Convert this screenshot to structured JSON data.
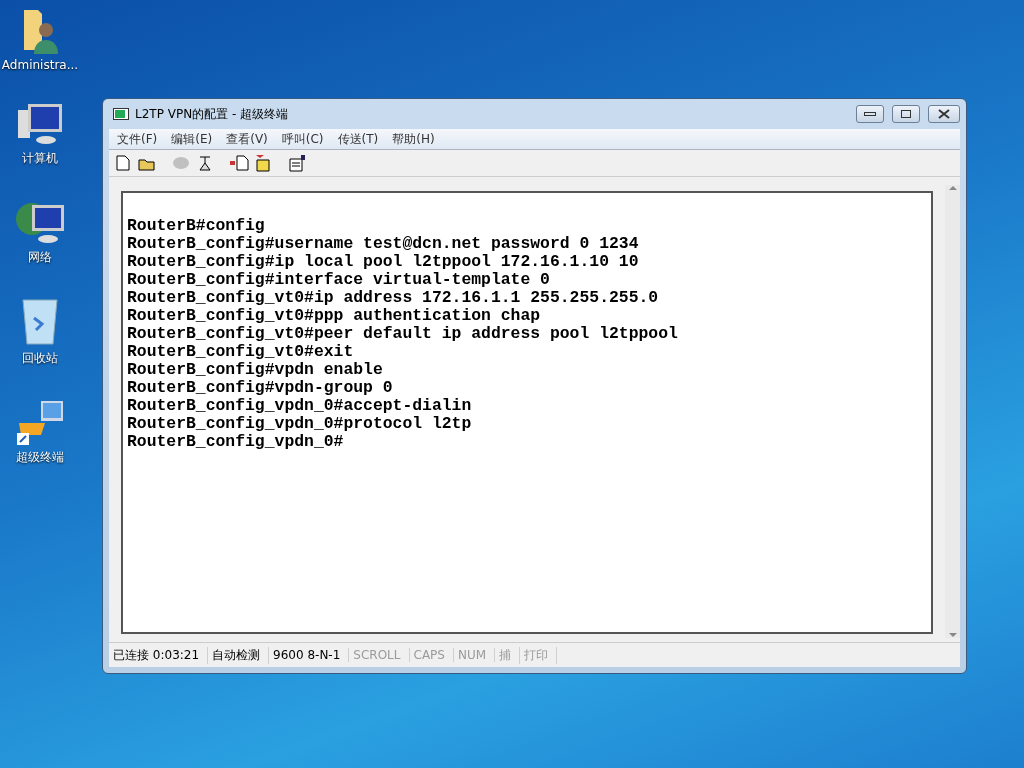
{
  "desktop_icons": [
    {
      "kind": "user-folder",
      "label": "Administra..."
    },
    {
      "kind": "computer",
      "label": "计算机"
    },
    {
      "kind": "network",
      "label": "网络"
    },
    {
      "kind": "recycle-bin",
      "label": "回收站"
    },
    {
      "kind": "terminal-shortcut",
      "label": "超级终端"
    }
  ],
  "window": {
    "title": "L2TP VPN的配置 - 超级终端"
  },
  "menu": [
    "文件(F)",
    "编辑(E)",
    "查看(V)",
    "呼叫(C)",
    "传送(T)",
    "帮助(H)"
  ],
  "toolbar": [
    {
      "kind": "new",
      "disabled": false
    },
    {
      "kind": "open",
      "disabled": false
    },
    {
      "kind": "disconnect",
      "disabled": true
    },
    {
      "kind": "dial",
      "disabled": false
    },
    {
      "kind": "send",
      "disabled": false
    },
    {
      "kind": "receive",
      "disabled": false
    },
    {
      "kind": "properties",
      "disabled": false
    }
  ],
  "terminal_lines": [
    "RouterB#config",
    "RouterB_config#username test@dcn.net password 0 1234",
    "RouterB_config#ip local pool l2tppool 172.16.1.10 10",
    "RouterB_config#interface virtual-template 0",
    "RouterB_config_vt0#ip address 172.16.1.1 255.255.255.0",
    "RouterB_config_vt0#ppp authentication chap",
    "RouterB_config_vt0#peer default ip address pool l2tppool",
    "RouterB_config_vt0#exit",
    "RouterB_config#vpdn enable",
    "RouterB_config#vpdn-group 0",
    "RouterB_config_vpdn_0#accept-dialin",
    "RouterB_config_vpdn_0#protocol l2tp",
    "RouterB_config_vpdn_0#"
  ],
  "status_bar": [
    {
      "text": "已连接 0:03:21",
      "disabled": false
    },
    {
      "text": "自动检测",
      "disabled": false
    },
    {
      "text": "9600 8-N-1",
      "disabled": false
    },
    {
      "text": "SCROLL",
      "disabled": true
    },
    {
      "text": "CAPS",
      "disabled": true
    },
    {
      "text": "NUM",
      "disabled": true
    },
    {
      "text": "捕",
      "disabled": true
    },
    {
      "text": "打印",
      "disabled": true
    }
  ]
}
